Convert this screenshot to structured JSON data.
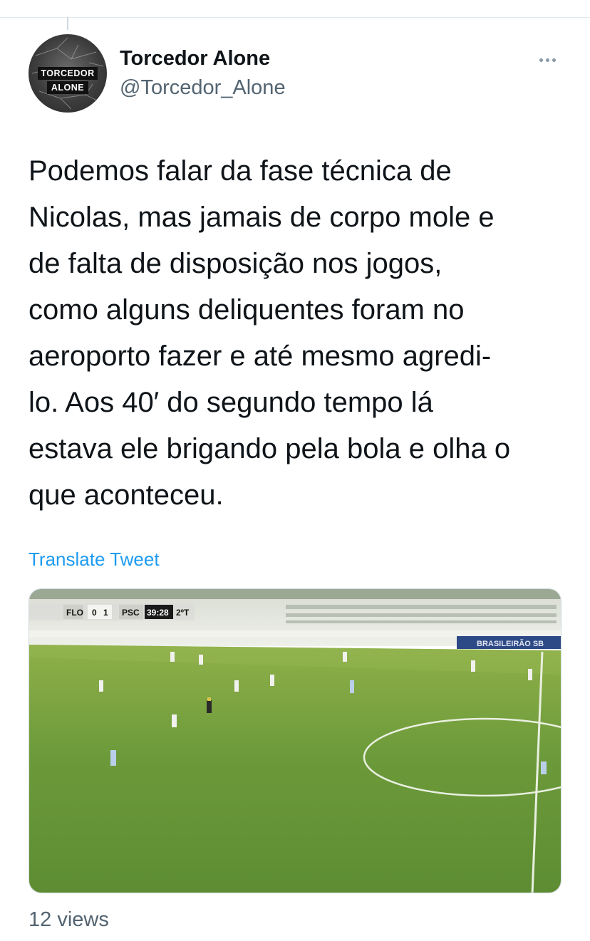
{
  "author": {
    "name": "Torcedor Alone",
    "handle": "@Torcedor_Alone",
    "avatar_text": [
      "TORCEDOR",
      "ALONE"
    ]
  },
  "more_icon": "ellipsis-icon",
  "tweet": {
    "lines": [
      "Podemos falar da fase técnica de",
      "Nicolas, mas jamais de corpo mole e",
      "de falta de disposição nos jogos,",
      "como alguns deliquentes foram no",
      "aeroporto fazer e até mesmo agredi-",
      "lo. Aos 40′ do segundo tempo lá",
      "estava ele brigando pela bola e olha o",
      "que aconteceu."
    ]
  },
  "translate_label": "Translate Tweet",
  "media": {
    "scoreboard": {
      "home_team": "FLO",
      "home_score": "0",
      "away_score": "1",
      "away_team": "PSC",
      "clock": "39:28",
      "period": "2ºT"
    },
    "board_text": "BRASILEIRÃO SB"
  },
  "views_label": "12 views",
  "colors": {
    "link": "#1d9bf0",
    "secondary_text": "#536471",
    "pitch": "#6a9a38"
  }
}
